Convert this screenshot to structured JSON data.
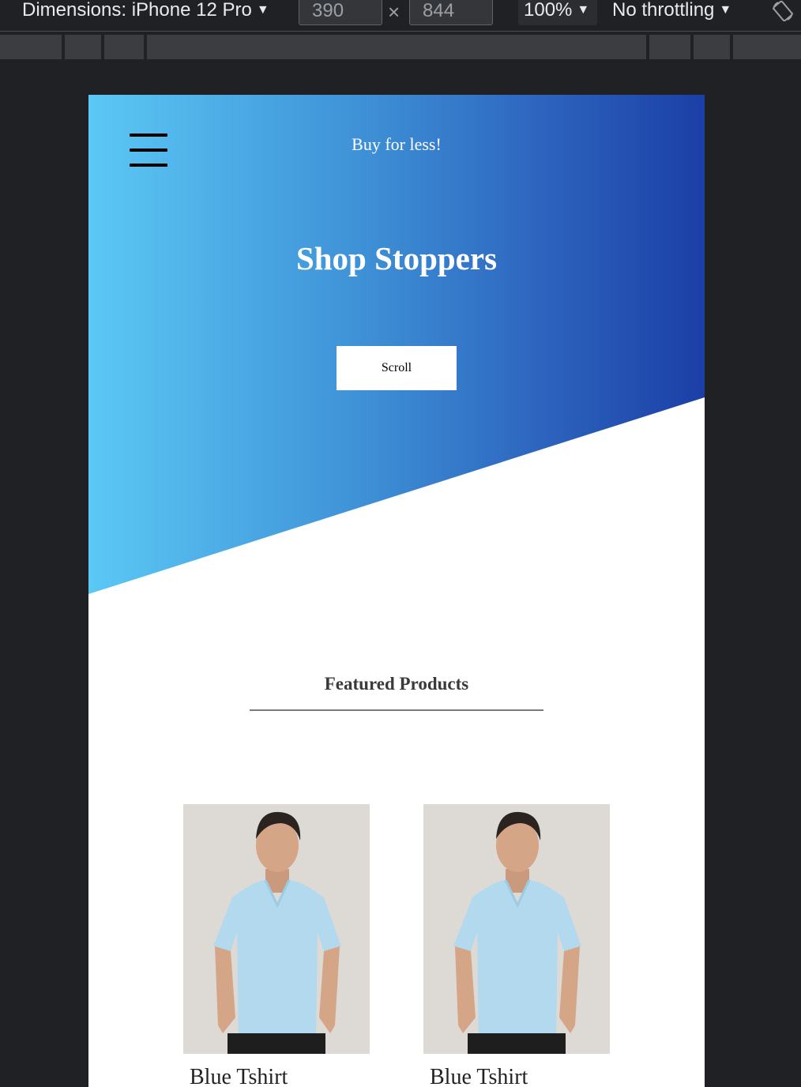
{
  "devtools": {
    "dimensions_label": "Dimensions: iPhone 12 Pro",
    "width_value": "390",
    "height_value": "844",
    "times_symbol": "×",
    "zoom_label": "100%",
    "throttling_label": "No throttling",
    "caret": "▼",
    "rotate_icon": "rotate-icon"
  },
  "header": {
    "tagline": "Buy for less!",
    "menu_icon": "hamburger-menu-icon"
  },
  "hero": {
    "title": "Shop Stoppers",
    "button_label": "Scroll",
    "gradient_colors": [
      "#5bc8f5",
      "#1b3fa6"
    ]
  },
  "featured": {
    "title": "Featured Products"
  },
  "products": [
    {
      "name": "Blue Tshirt",
      "image": "man in light blue v-neck t-shirt"
    },
    {
      "name": "Blue Tshirt",
      "image": "man in light blue v-neck t-shirt"
    }
  ]
}
